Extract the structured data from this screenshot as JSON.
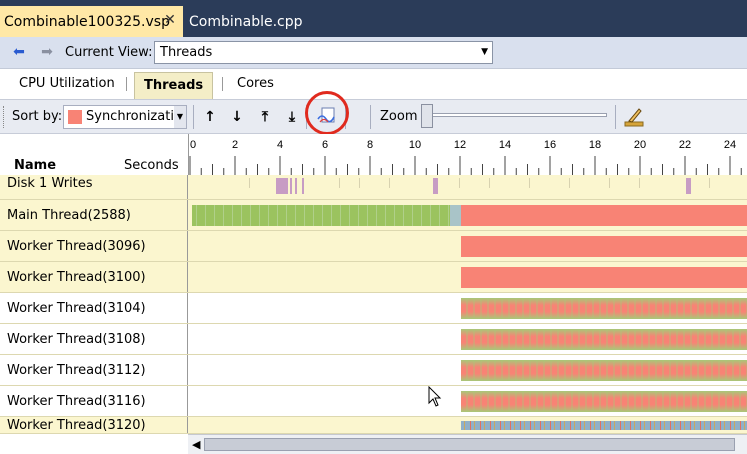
{
  "tabs": [
    {
      "label": "Combinable100325.vsp",
      "active": true
    },
    {
      "label": "Combinable.cpp",
      "active": false
    }
  ],
  "viewbar": {
    "label": "Current View:",
    "selected": "Threads"
  },
  "subtabs": [
    "CPU Utilization",
    "Threads",
    "Cores"
  ],
  "toolbar": {
    "sort_label": "Sort by:",
    "sort_value": "Synchronization",
    "zoom_label": "Zoom",
    "zoom_level": 0
  },
  "header": {
    "name": "Name",
    "seconds": "Seconds"
  },
  "ruler_ticks": [
    "0",
    "2",
    "4",
    "6",
    "8",
    "10",
    "12",
    "14",
    "16",
    "18",
    "20",
    "22",
    "24"
  ],
  "rows": [
    {
      "name": "Disk 1 Writes"
    },
    {
      "name": "Main Thread(2588)"
    },
    {
      "name": "Worker Thread(3096)"
    },
    {
      "name": "Worker Thread(3100)"
    },
    {
      "name": "Worker Thread(3104)"
    },
    {
      "name": "Worker Thread(3108)"
    },
    {
      "name": "Worker Thread(3112)"
    },
    {
      "name": "Worker Thread(3116)"
    },
    {
      "name": "Worker Thread(3120)"
    }
  ],
  "colors": {
    "synchronization": "#f88375",
    "execution": "#9bc35f",
    "io": "#c79cc4",
    "highlight_row": "#fbf6cf",
    "ring": "#e02a1e"
  },
  "icons": [
    "back-arrow-icon",
    "forward-arrow-icon",
    "move-up-icon",
    "move-down-icon",
    "move-top-icon",
    "move-bottom-icon",
    "visible-timeline-profile-icon",
    "highlighter-icon"
  ]
}
